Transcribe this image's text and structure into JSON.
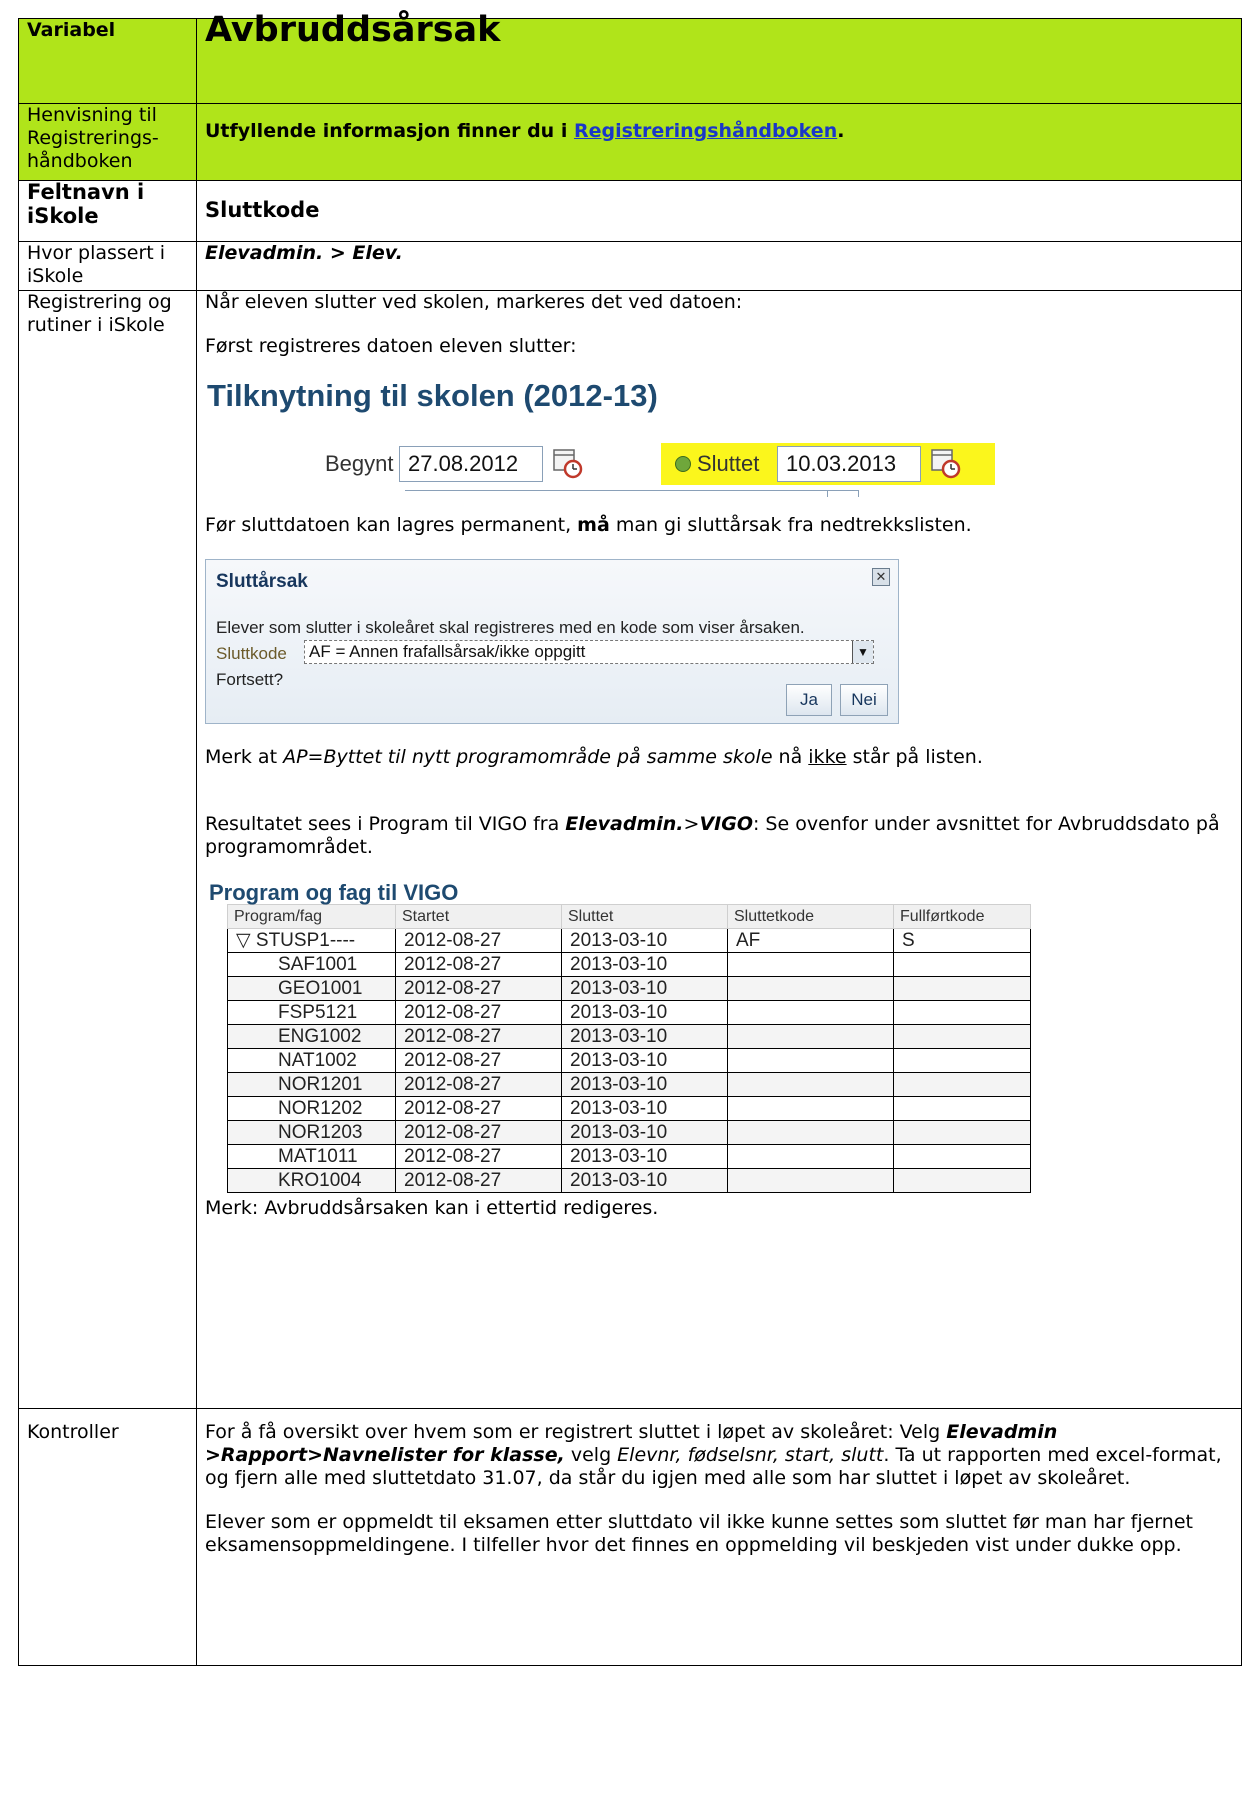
{
  "header": {
    "label": "Variabel",
    "title": "Avbruddsårsak"
  },
  "reference": {
    "label": "Henvisning til Registrerings-håndboken",
    "text_before": "Utfyllende informasjon finner du i ",
    "link": "Registreringshåndboken",
    "text_after": "."
  },
  "fieldname": {
    "label": "Feltnavn i iSkole",
    "value": "Sluttkode"
  },
  "location": {
    "label": "Hvor plassert i iSkole",
    "value": "Elevadmin. > Elev."
  },
  "registration": {
    "label": "Registrering og rutiner i iSkole",
    "p1": "Når eleven slutter ved skolen, markeres det ved datoen:",
    "p2": "Først registreres datoen eleven slutter:",
    "screenshot1": {
      "heading": "Tilknytning til skolen (2012-13)",
      "begynt_label": "Begynt",
      "begynt_value": "27.08.2012",
      "sluttet_label": "Sluttet",
      "sluttet_value": "10.03.2013"
    },
    "p3_before": "Før sluttdatoen kan lagres permanent, ",
    "p3_bold": "må",
    "p3_after": " man gi sluttårsak fra nedtrekkslisten.",
    "dialog": {
      "title": "Sluttårsak",
      "message": "Elever som slutter i skoleåret skal registreres med en kode som viser årsaken.",
      "field_label": "Sluttkode",
      "selected": "AF = Annen frafallsårsak/ikke oppgitt",
      "question": "Fortsett?",
      "yes": "Ja",
      "no": "Nei"
    },
    "p4_before": "Merk at ",
    "p4_italic": "AP=Byttet til nytt programområde på samme skole",
    "p4_mid": " nå ",
    "p4_underline": "ikke",
    "p4_after": " står på listen.",
    "p5_before": "Resultatet sees i Program til VIGO fra ",
    "p5_bi1": "Elevadmin.",
    "p5_sep": ">",
    "p5_bi2": "VIGO",
    "p5_after": ": Se ovenfor under avsnittet for Avbruddsdato på programområdet.",
    "vigo": {
      "title": "Program og fag til VIGO",
      "columns": [
        "Program/fag",
        "Startet",
        "Sluttet",
        "Sluttetkode",
        "Fullførtkode"
      ],
      "rows": [
        [
          "STUSP1----",
          "2012-08-27",
          "2013-03-10",
          "AF",
          "S"
        ],
        [
          "SAF1001",
          "2012-08-27",
          "2013-03-10",
          "",
          ""
        ],
        [
          "GEO1001",
          "2012-08-27",
          "2013-03-10",
          "",
          ""
        ],
        [
          "FSP5121",
          "2012-08-27",
          "2013-03-10",
          "",
          ""
        ],
        [
          "ENG1002",
          "2012-08-27",
          "2013-03-10",
          "",
          ""
        ],
        [
          "NAT1002",
          "2012-08-27",
          "2013-03-10",
          "",
          ""
        ],
        [
          "NOR1201",
          "2012-08-27",
          "2013-03-10",
          "",
          ""
        ],
        [
          "NOR1202",
          "2012-08-27",
          "2013-03-10",
          "",
          ""
        ],
        [
          "NOR1203",
          "2012-08-27",
          "2013-03-10",
          "",
          ""
        ],
        [
          "MAT1011",
          "2012-08-27",
          "2013-03-10",
          "",
          ""
        ],
        [
          "KRO1004",
          "2012-08-27",
          "2013-03-10",
          "",
          ""
        ]
      ]
    },
    "p6": "Merk: Avbruddsårsaken kan i ettertid redigeres."
  },
  "controls": {
    "label": "Kontroller",
    "p1_before": "For å få oversikt over hvem som er registrert sluttet i løpet av skoleåret: Velg ",
    "p1_bi": "Elevadmin >Rapport>Navnelister for klasse,",
    "p1_mid": " velg ",
    "p1_italic": "Elevnr, fødselsnr, start, slutt",
    "p1_after": ". Ta ut rapporten med excel-format, og fjern alle med sluttetdato 31.07, da står du igjen med alle som har sluttet i løpet av skoleåret.",
    "p2": "Elever som er oppmeldt til eksamen etter sluttdato vil ikke kunne settes som sluttet før man har fjernet eksamensoppmeldingene. I tilfeller hvor det finnes en oppmelding vil beskjeden vist under dukke opp."
  },
  "colors": {
    "header_green": "#b0e41a",
    "highlight_yellow": "#fbf61c",
    "link_blue": "#1a37c8",
    "heading_blue": "#1e4a70"
  }
}
